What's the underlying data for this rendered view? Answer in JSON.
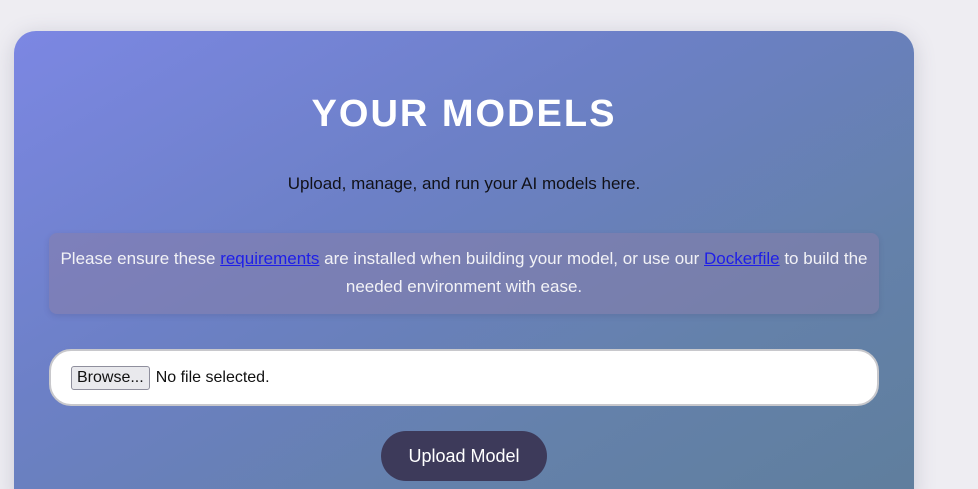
{
  "header": {
    "title": "YOUR MODELS",
    "subtitle": "Upload, manage, and run your AI models here."
  },
  "notice": {
    "text_before": "Please ensure these ",
    "link_requirements": "requirements",
    "text_middle": " are installed when building your model, or use our ",
    "link_dockerfile": "Dockerfile",
    "text_after": " to build the needed environment with ease."
  },
  "file_input": {
    "browse_label": "Browse...",
    "status": "No file selected."
  },
  "actions": {
    "upload_label": "Upload Model"
  },
  "colors": {
    "card_gradient_start": "#7c87e3",
    "card_gradient_end": "#5f7e9c",
    "link": "#1e1ee8",
    "upload_button": "#3d3a5a"
  }
}
